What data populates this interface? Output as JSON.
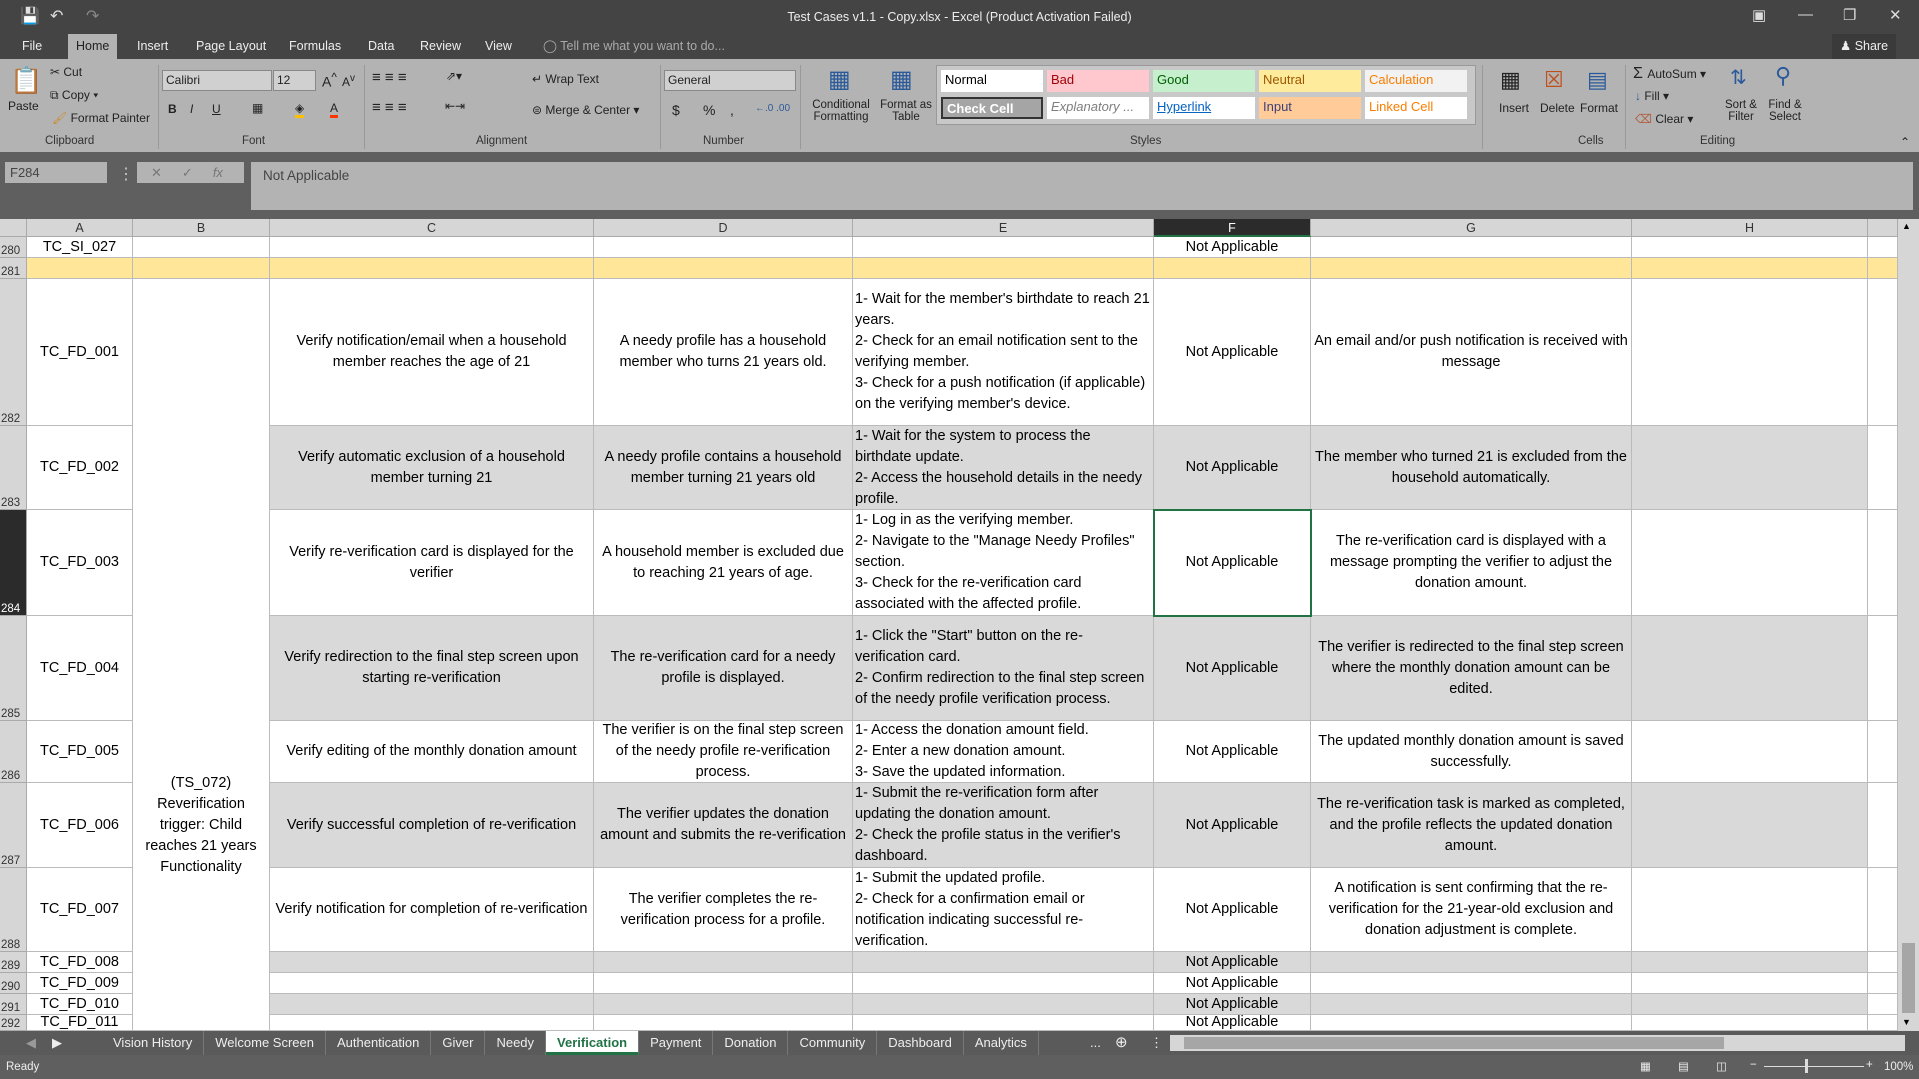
{
  "window": {
    "title": "Test Cases v1.1 - Copy.xlsx - Excel (Product Activation Failed)",
    "share": "Share"
  },
  "ribbon_tabs": [
    "File",
    "Home",
    "Insert",
    "Page Layout",
    "Formulas",
    "Data",
    "Review",
    "View"
  ],
  "tell_me": "Tell me what you want to do...",
  "clipboard": {
    "paste": "Paste",
    "cut": "Cut",
    "copy": "Copy",
    "format_painter": "Format Painter",
    "group": "Clipboard"
  },
  "font": {
    "name": "Calibri",
    "size": "12",
    "group": "Font",
    "bold": "B",
    "italic": "I",
    "underline": "U"
  },
  "alignment": {
    "wrap": "Wrap Text",
    "merge": "Merge & Center",
    "group": "Alignment"
  },
  "number": {
    "format": "General",
    "currency": "$",
    "percent": "%",
    "comma": ",",
    "group": "Number"
  },
  "styles": {
    "conditional": "Conditional Formatting",
    "format_table": "Format as Table",
    "group": "Styles",
    "items": [
      {
        "label": "Normal",
        "bg": "#ffffff",
        "fg": "#000000"
      },
      {
        "label": "Bad",
        "bg": "#ffc7ce",
        "fg": "#9c0006"
      },
      {
        "label": "Good",
        "bg": "#c6efce",
        "fg": "#006100"
      },
      {
        "label": "Neutral",
        "bg": "#ffeb9c",
        "fg": "#9c5700"
      },
      {
        "label": "Calculation",
        "bg": "#f2f2f2",
        "fg": "#fa7d00"
      },
      {
        "label": "Check Cell",
        "bg": "#a5a5a5",
        "fg": "#ffffff"
      },
      {
        "label": "Explanatory ...",
        "bg": "#ffffff",
        "fg": "#7f7f7f"
      },
      {
        "label": "Hyperlink",
        "bg": "#ffffff",
        "fg": "#0563c1"
      },
      {
        "label": "Input",
        "bg": "#ffcc99",
        "fg": "#3f3f76"
      },
      {
        "label": "Linked Cell",
        "bg": "#ffffff",
        "fg": "#fa7d00"
      }
    ]
  },
  "cells_group": {
    "insert": "Insert",
    "delete": "Delete",
    "format": "Format",
    "group": "Cells"
  },
  "editing": {
    "autosum": "AutoSum",
    "fill": "Fill",
    "clear": "Clear",
    "sort": "Sort & Filter",
    "find": "Find & Select",
    "group": "Editing"
  },
  "formula_bar": {
    "name_box": "F284",
    "fx": "fx",
    "value": "Not Applicable"
  },
  "columns": [
    "A",
    "B",
    "C",
    "D",
    "E",
    "F",
    "G",
    "H"
  ],
  "selected_cell": "F284",
  "merged_b": "(TS_072)\nReverification trigger: Child reaches 21 years Functionality",
  "rows": [
    {
      "num": "280",
      "cells": [
        "TC_SI_027",
        "",
        "",
        "",
        "",
        "Not Applicable",
        "",
        ""
      ]
    },
    {
      "num": "281",
      "cells": [
        "",
        "",
        "",
        "",
        "",
        "",
        "",
        ""
      ]
    },
    {
      "num": "282",
      "cells": [
        "TC_FD_001",
        "",
        "Verify notification/email when a household member reaches the age of 21",
        "A needy profile has a household member who turns 21 years old.",
        "1- Wait for the member's birthdate to reach 21 years.\n2- Check for an email notification sent to the verifying member.\n3- Check for a push notification (if applicable) on the verifying member's device.",
        "Not Applicable",
        "An email and/or push notification is received with message",
        ""
      ]
    },
    {
      "num": "283",
      "cells": [
        "TC_FD_002",
        "",
        "Verify automatic exclusion of a household member turning 21",
        "A needy profile contains a household member turning 21 years old",
        "1- Wait for the system to process the birthdate update.\n2- Access the household details in the needy profile.",
        "Not Applicable",
        "The member who turned 21 is excluded from the household automatically.",
        ""
      ]
    },
    {
      "num": "284",
      "cells": [
        "TC_FD_003",
        "",
        "Verify re-verification card is displayed for the verifier",
        "A household member is excluded due to reaching 21 years of age.",
        "1- Log in as the verifying member.\n2- Navigate to the \"Manage Needy Profiles\" section.\n3- Check for the re-verification card associated with the affected profile.",
        "Not Applicable",
        "The re-verification card is displayed with a message prompting the verifier to adjust the donation amount.",
        ""
      ]
    },
    {
      "num": "285",
      "cells": [
        "TC_FD_004",
        "",
        "Verify redirection to the final step screen upon starting re-verification",
        "The re-verification card for a needy profile is displayed.",
        "1- Click the \"Start\" button on the re-verification card.\n2- Confirm redirection to the final step screen of the needy profile verification process.",
        "Not Applicable",
        "The verifier is redirected to the final step screen where the monthly donation amount can be edited.",
        ""
      ]
    },
    {
      "num": "286",
      "cells": [
        "TC_FD_005",
        "",
        "Verify editing of the monthly donation amount",
        "The verifier is on the final step screen of the needy profile re-verification process.",
        "1- Access the donation amount field.\n2- Enter a new donation amount.\n3- Save the updated information.",
        "Not Applicable",
        "The updated monthly donation amount is saved successfully.",
        ""
      ]
    },
    {
      "num": "287",
      "cells": [
        "TC_FD_006",
        "",
        "Verify successful completion of re-verification",
        "The verifier updates the donation amount and submits the re-verification",
        "1- Submit the re-verification form after updating the donation amount.\n2- Check the profile status in the verifier's dashboard.",
        "Not Applicable",
        "The re-verification task is marked as completed, and the profile reflects the updated donation amount.",
        ""
      ]
    },
    {
      "num": "288",
      "cells": [
        "TC_FD_007",
        "",
        "Verify notification for completion of re-verification",
        "The verifier completes the re-verification process for a profile.",
        "1- Submit the updated profile.\n2- Check for a confirmation email or notification indicating successful re-verification.",
        "Not Applicable",
        "A notification is sent confirming that the re-verification for the 21-year-old exclusion and donation adjustment is complete.",
        ""
      ]
    },
    {
      "num": "289",
      "cells": [
        "TC_FD_008",
        "",
        "",
        "",
        "",
        "Not Applicable",
        "",
        ""
      ]
    },
    {
      "num": "290",
      "cells": [
        "TC_FD_009",
        "",
        "",
        "",
        "",
        "Not Applicable",
        "",
        ""
      ]
    },
    {
      "num": "291",
      "cells": [
        "TC_FD_010",
        "",
        "",
        "",
        "",
        "Not Applicable",
        "",
        ""
      ]
    },
    {
      "num": "292",
      "cells": [
        "TC_FD_011",
        "",
        "",
        "",
        "",
        "Not Applicable",
        "",
        ""
      ]
    }
  ],
  "sheet_tabs": [
    "Vision History",
    "Welcome Screen",
    "Authentication",
    "Giver",
    "Needy",
    "Verification",
    "Payment",
    "Donation",
    "Community",
    "Dashboard",
    "Analytics"
  ],
  "active_sheet": "Verification",
  "more_sheets": "...",
  "status": {
    "ready": "Ready",
    "zoom": "100%"
  }
}
